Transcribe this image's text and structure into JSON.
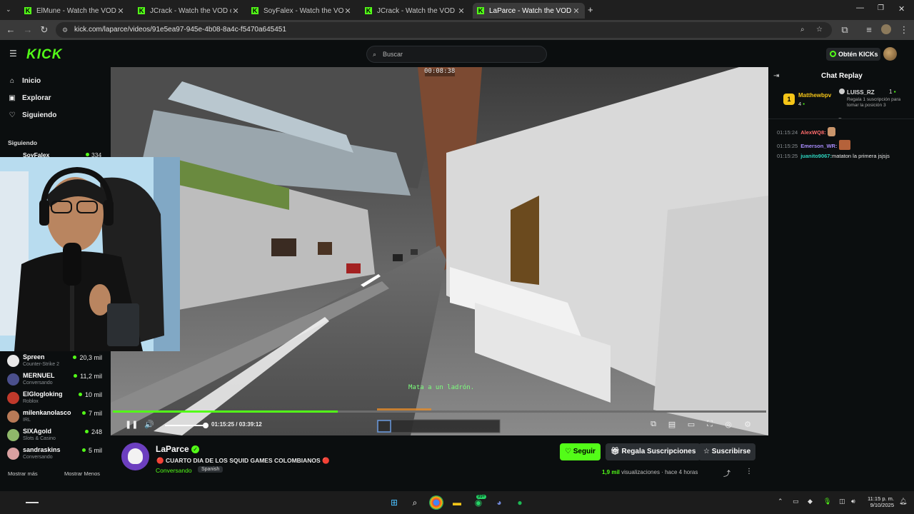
{
  "browser": {
    "tabs": [
      {
        "title": "ElMune - Watch the VOD on Ki"
      },
      {
        "title": "JCrack - Watch the VOD on Kic"
      },
      {
        "title": "SoyFalex - Watch the VOD on K"
      },
      {
        "title": "JCrack - Watch the VOD on Kic"
      },
      {
        "title": "LaParce - Watch the VOD on Ki"
      }
    ],
    "url": "kick.com/laparce/videos/91e5ea97-945e-4b08-8a4c-f5470a645451"
  },
  "header": {
    "logo": "KICK",
    "search_placeholder": "Buscar",
    "kicks_label": "Obtén KICKs"
  },
  "sidebar": {
    "nav": [
      {
        "label": "Inicio"
      },
      {
        "label": "Explorar"
      },
      {
        "label": "Siguiendo"
      }
    ],
    "following_heading": "Siguiendo",
    "top_channel": {
      "name": "SoyFalex",
      "viewers": "334"
    },
    "channels": [
      {
        "name": "Spreen",
        "game": "Counter-Strike 2",
        "viewers": "20,3 mil",
        "color": "#e8e8e8"
      },
      {
        "name": "MERNUEL",
        "game": "Conversando",
        "viewers": "11,2 mil",
        "color": "#4a4f8c"
      },
      {
        "name": "ElGlogloking",
        "game": "Roblox",
        "viewers": "10 mil",
        "color": "#c0392b"
      },
      {
        "name": "milenkanolasco",
        "game": "IRL",
        "viewers": "7 mil",
        "color": "#b97a57"
      },
      {
        "name": "SIXAgold",
        "game": "Slots & Casino",
        "viewers": "248",
        "color": "#8fb86a"
      },
      {
        "name": "sandraskins",
        "game": "Conversando",
        "viewers": "5 mil",
        "color": "#d9a0a0"
      }
    ],
    "show_more": "Mostrar más",
    "show_less": "Mostrar Menos"
  },
  "player": {
    "overlay_timer": "00:08:38",
    "game_subtitle": "Mata a un ladrón.",
    "time": "01:15:25 / 03:39:12",
    "progress": 0.344
  },
  "stream": {
    "streamer": "LaParce",
    "title": "🔴 CUARTO DIA DE LOS SQUID GAMES COLOMBIANOS 🔴",
    "category": "Conversando",
    "language": "Spanish",
    "follow": "Seguir",
    "gift_subs": "Regala Suscripciones",
    "subscribe": "Suscribirse",
    "views_count": "1,9 mil",
    "views_label": "visualizaciones",
    "ago": "hace 4 horas"
  },
  "chat": {
    "title": "Chat Replay",
    "leader_1": {
      "name": "Matthewbpv",
      "count": "4"
    },
    "leader_2": {
      "name": "LUISS_RZ",
      "count": "1",
      "note": "Regala 1 suscripción para tomar la posición 3"
    },
    "messages": [
      {
        "time": "01:15:24",
        "user": "AlexWQ8:",
        "text": "",
        "color": "#ff6b6b"
      },
      {
        "time": "01:15:25",
        "user": "Emerson_WR:",
        "text": "",
        "color": "#a78bfa"
      },
      {
        "time": "01:15:25",
        "user": "juanito9067:",
        "text": "mataton la primera jsjsjs",
        "color": "#2dd4bf"
      }
    ]
  },
  "taskbar": {
    "time": "11:15 p. m.",
    "date": "9/10/2025",
    "whatsapp_badge": "99+"
  },
  "colors": {
    "kick_green": "#53fc18",
    "background": "#0b0e0f"
  }
}
